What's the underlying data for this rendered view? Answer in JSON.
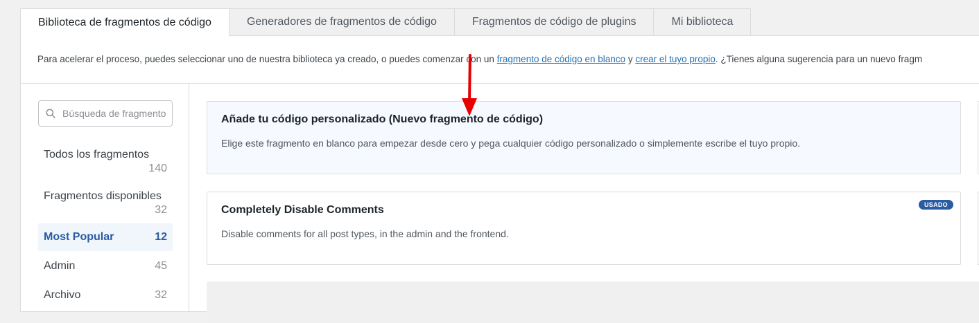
{
  "tabs": [
    {
      "label": "Biblioteca de fragmentos de código",
      "active": true
    },
    {
      "label": "Generadores de fragmentos de código",
      "active": false
    },
    {
      "label": "Fragmentos de código de plugins",
      "active": false
    },
    {
      "label": "Mi biblioteca",
      "active": false
    }
  ],
  "intro": {
    "text_before": "Para acelerar el proceso, puedes seleccionar uno de nuestra biblioteca ya creado, o puedes comenzar con un ",
    "link1": "fragmento de código en blanco",
    "text_mid": " y ",
    "link2": "crear el tuyo propio",
    "text_after": ". ¿Tienes alguna sugerencia para un nuevo fragm"
  },
  "search": {
    "placeholder": "Búsqueda de fragmentos",
    "icon": "search-icon"
  },
  "categories": [
    {
      "name": "Todos los fragmentos",
      "count": "140"
    },
    {
      "name": "Fragmentos disponibles",
      "count": "32"
    },
    {
      "name": "Most Popular",
      "count": "12",
      "active": true
    },
    {
      "name": "Admin",
      "count": "45"
    },
    {
      "name": "Archivo",
      "count": "32"
    }
  ],
  "cards": [
    {
      "title": "Añade tu código personalizado (Nuevo fragmento de código)",
      "description": "Elige este fragmento en blanco para empezar desde cero y pega cualquier código personalizado o simplemente escribe el tuyo propio."
    },
    {
      "title": "Completely Disable Comments",
      "description": "Disable comments for all post types, in the admin and the frontend.",
      "badge": "USADO"
    }
  ],
  "colors": {
    "accent": "#2a5ba3",
    "link": "#2271b1",
    "arrow": "#e60000",
    "blank_card_bg": "#f6f9ff"
  }
}
